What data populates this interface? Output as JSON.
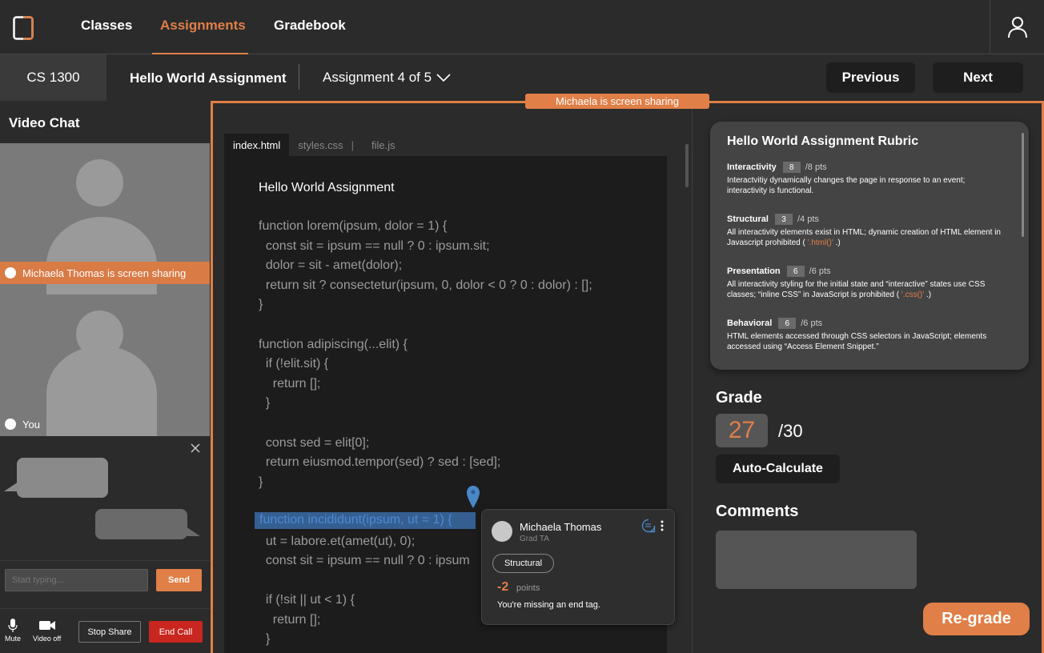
{
  "nav": {
    "tabs": [
      "Classes",
      "Assignments",
      "Gradebook"
    ]
  },
  "subheader": {
    "course": "CS 1300",
    "assignment_title": "Hello World Assignment",
    "assignment_count": "Assignment 4 of 5",
    "previous": "Previous",
    "next": "Next"
  },
  "video_chat": {
    "title": "Video Chat",
    "participant1": "Michaela Thomas is screen sharing",
    "participant2": "You",
    "input_placeholder": "Start typing...",
    "send": "Send",
    "mute": "Mute",
    "video_off": "Video off",
    "stop_share": "Stop Share",
    "end_call": "End Call"
  },
  "share_banner": "Michaela is screen sharing",
  "editor": {
    "tabs": [
      "index.html",
      "styles.css",
      "file.js"
    ],
    "title": "Hello World Assignment",
    "code_lines": [
      "function lorem(ipsum, dolor = 1) {",
      "  const sit = ipsum == null ? 0 : ipsum.sit;",
      "  dolor = sit - amet(dolor);",
      "  return sit ? consectetur(ipsum, 0, dolor < 0 ? 0 : dolor) : [];",
      "}",
      "",
      "function adipiscing(...elit) {",
      "  if (!elit.sit) {",
      "    return [];",
      "  }",
      "",
      "  const sed = elit[0];",
      "  return eiusmod.tempor(sed) ? sed : [sed];",
      "}",
      "",
      "",
      "  ut = labore.et(amet(ut), 0);",
      "  const sit = ipsum == null ? 0 : ipsum",
      "",
      "  if (!sit || ut < 1) {",
      "    return [];",
      "  }"
    ],
    "highlighted_line": "function incididunt(ipsum, ut = 1) {"
  },
  "comment": {
    "name": "Michaela Thomas",
    "role": "Grad TA",
    "tag": "Structural",
    "points": "-2",
    "points_label": "points",
    "message": "You're missing an end tag."
  },
  "rubric": {
    "title": "Hello World Assignment Rubric",
    "items": [
      {
        "name": "Interactivity",
        "score": "8",
        "max": "/8 pts",
        "desc": "Interactvitiy dynamically changes the page in response to an event; interactivity is functional.",
        "code": "",
        "tail": ""
      },
      {
        "name": "Structural",
        "score": "3",
        "max": "/4 pts",
        "desc": "All interactivity elements exist in HTML; dynamic creation of HTML element in Javascript prohibited ( ",
        "code": "'.html()'",
        "tail": " .)"
      },
      {
        "name": "Presentation",
        "score": "6",
        "max": "/6 pts",
        "desc": "All interactivity styling for the initial state and “interactive” states use CSS classes; “inline CSS” in JavaScript is prohibited ( ",
        "code": "'.css()'",
        "tail": " .)"
      },
      {
        "name": "Behavioral",
        "score": "6",
        "max": "/6 pts",
        "desc": "HTML elements accessed through CSS selectors in JavaScript; elements accessed using “Access Element Snippet.”",
        "code": "",
        "tail": ""
      }
    ]
  },
  "grade": {
    "label": "Grade",
    "value": "27",
    "max": "/30",
    "auto_calculate": "Auto-Calculate"
  },
  "comments_label": "Comments",
  "regrade": "Re-grade",
  "colors": {
    "accent": "#e07f47",
    "end_call": "#c8261f",
    "highlight": "#365f91"
  }
}
